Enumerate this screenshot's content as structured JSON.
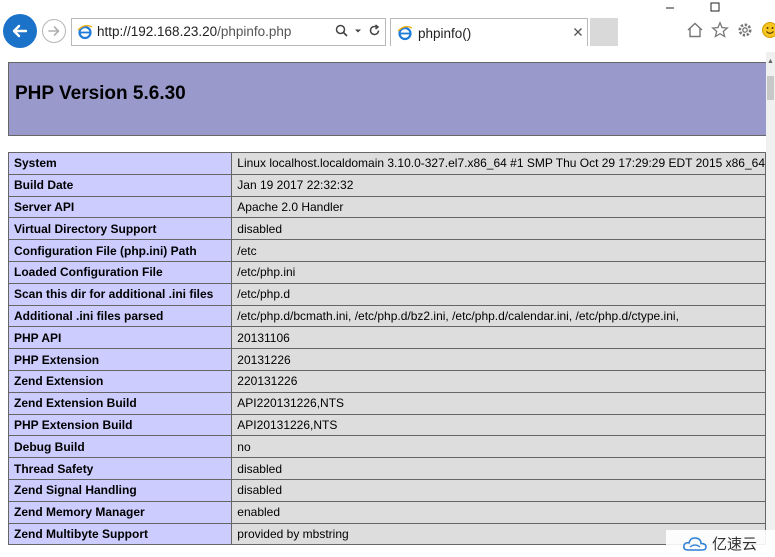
{
  "browser": {
    "url_host": "http://192.168.23.20",
    "url_path": "/phpinfo.php",
    "tab_title": "phpinfo()",
    "icons": [
      "back-arrow-icon",
      "forward-arrow-icon",
      "ie-logo-icon",
      "search-icon",
      "dropdown-icon",
      "refresh-icon",
      "close-icon",
      "home-icon",
      "star-icon",
      "gear-icon",
      "smiley-icon",
      "minimize-icon",
      "maximize-icon"
    ]
  },
  "page": {
    "title": "PHP Version 5.6.30",
    "rows": [
      {
        "key": "System",
        "value": "Linux localhost.localdomain 3.10.0-327.el7.x86_64 #1 SMP Thu Oct 29 17:29:29 EDT 2015 x86_64"
      },
      {
        "key": "Build Date",
        "value": "Jan 19 2017 22:32:32"
      },
      {
        "key": "Server API",
        "value": "Apache 2.0 Handler"
      },
      {
        "key": "Virtual Directory Support",
        "value": "disabled"
      },
      {
        "key": "Configuration File (php.ini) Path",
        "value": "/etc"
      },
      {
        "key": "Loaded Configuration File",
        "value": "/etc/php.ini"
      },
      {
        "key": "Scan this dir for additional .ini files",
        "value": "/etc/php.d"
      },
      {
        "key": "Additional .ini files parsed",
        "value": "/etc/php.d/bcmath.ini, /etc/php.d/bz2.ini, /etc/php.d/calendar.ini, /etc/php.d/ctype.ini,"
      },
      {
        "key": "PHP API",
        "value": "20131106"
      },
      {
        "key": "PHP Extension",
        "value": "20131226"
      },
      {
        "key": "Zend Extension",
        "value": "220131226"
      },
      {
        "key": "Zend Extension Build",
        "value": "API220131226,NTS"
      },
      {
        "key": "PHP Extension Build",
        "value": "API20131226,NTS"
      },
      {
        "key": "Debug Build",
        "value": "no"
      },
      {
        "key": "Thread Safety",
        "value": "disabled"
      },
      {
        "key": "Zend Signal Handling",
        "value": "disabled"
      },
      {
        "key": "Zend Memory Manager",
        "value": "enabled"
      },
      {
        "key": "Zend Multibyte Support",
        "value": "provided by mbstring"
      }
    ]
  },
  "watermark": {
    "text": "亿速云"
  },
  "colors": {
    "header_bg": "#9999cc",
    "key_bg": "#ccccff",
    "value_bg": "#dddddd",
    "back_button": "#1a73c9"
  }
}
